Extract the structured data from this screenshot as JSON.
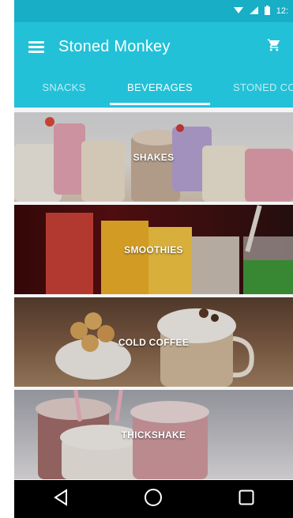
{
  "status_bar": {
    "time": "12:"
  },
  "app_bar": {
    "title": "Stoned Monkey"
  },
  "tabs": [
    {
      "label": "SNACKS",
      "active": false
    },
    {
      "label": "BEVERAGES",
      "active": true
    },
    {
      "label": "STONED CO",
      "active": false
    }
  ],
  "categories": [
    {
      "label": "SHAKES"
    },
    {
      "label": "SMOOTHIES"
    },
    {
      "label": "COLD COFFEE"
    },
    {
      "label": "THICKSHAKE"
    }
  ],
  "colors": {
    "primary": "#22c1d8",
    "status_bar": "#17aec6",
    "tab_text_inactive": "rgba(255,255,255,0.72)",
    "nav_bar": "#000000"
  },
  "icons": {
    "menu": "hamburger-icon",
    "cart": "cart-icon",
    "back": "back-triangle-icon",
    "home": "home-circle-icon",
    "recents": "recents-square-icon"
  }
}
